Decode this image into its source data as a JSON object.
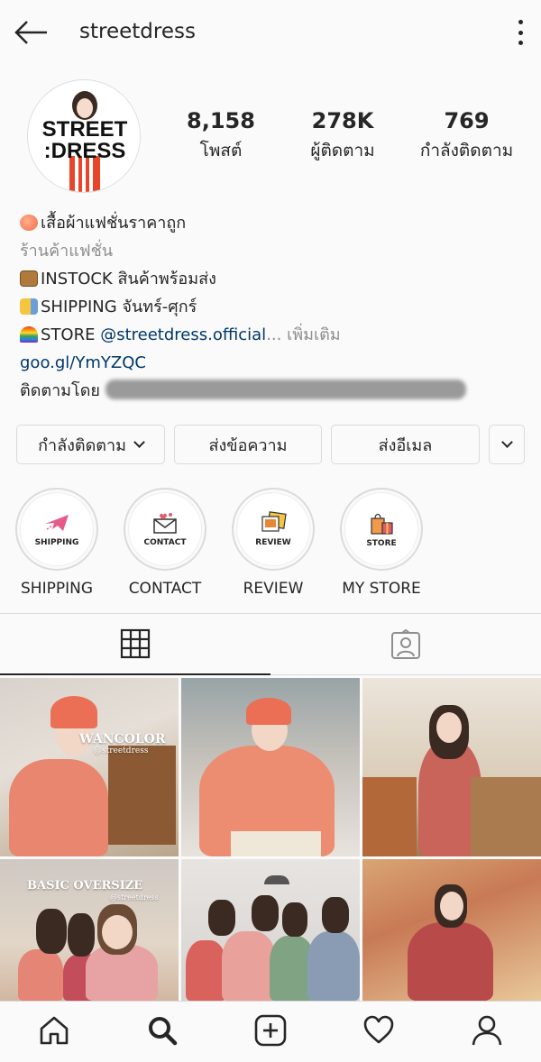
{
  "header": {
    "username": "streetdress"
  },
  "profile": {
    "avatar_line1": "STREET",
    "avatar_line2": ":DRESS",
    "stats": [
      {
        "value": "8,158",
        "label": "โพสต์"
      },
      {
        "value": "278K",
        "label": "ผู้ติดตาม"
      },
      {
        "value": "769",
        "label": "กำลังติดตาม"
      }
    ]
  },
  "bio": {
    "name": "เสื้อผ้าแฟชั่นราคาถูก",
    "category": "ร้านค้าแฟชั่น",
    "line_instock": "INSTOCK สินค้าพร้อมส่ง",
    "line_shipping": "SHIPPING จันทร์-ศุกร์",
    "line_store_prefix": "STORE ",
    "line_store_handle": "@streetdress.official",
    "line_store_more": "... เพิ่มเติม",
    "link": "goo.gl/YmYZQC",
    "followed_by": "ติดตามโดย"
  },
  "buttons": {
    "following": "กำลังติดตาม",
    "message": "ส่งข้อความ",
    "email": "ส่งอีเมล"
  },
  "highlights": [
    {
      "inner": "SHIPPING",
      "label": "SHIPPING"
    },
    {
      "inner": "CONTACT",
      "label": "CONTACT"
    },
    {
      "inner": "REVIEW",
      "label": "REVIEW"
    },
    {
      "inner": "STORE",
      "label": "MY STORE"
    }
  ],
  "tabs": {
    "grid_icon": "grid-icon",
    "tagged_icon": "tagged-icon"
  },
  "posts": {
    "post1_title": "WANCOLOR",
    "post1_handle": "@streetdress",
    "post4_title": "BASIC OVERSIZE",
    "post4_handle": "@streetdress"
  },
  "nav": {
    "icons": [
      "home-icon",
      "search-icon",
      "add-post-icon",
      "activity-heart-icon",
      "profile-icon"
    ]
  },
  "colors": {
    "text": "#262626",
    "secondary": "#8e8e8e",
    "link": "#00376b",
    "border": "#dbdbdb",
    "background": "#fafafa"
  }
}
